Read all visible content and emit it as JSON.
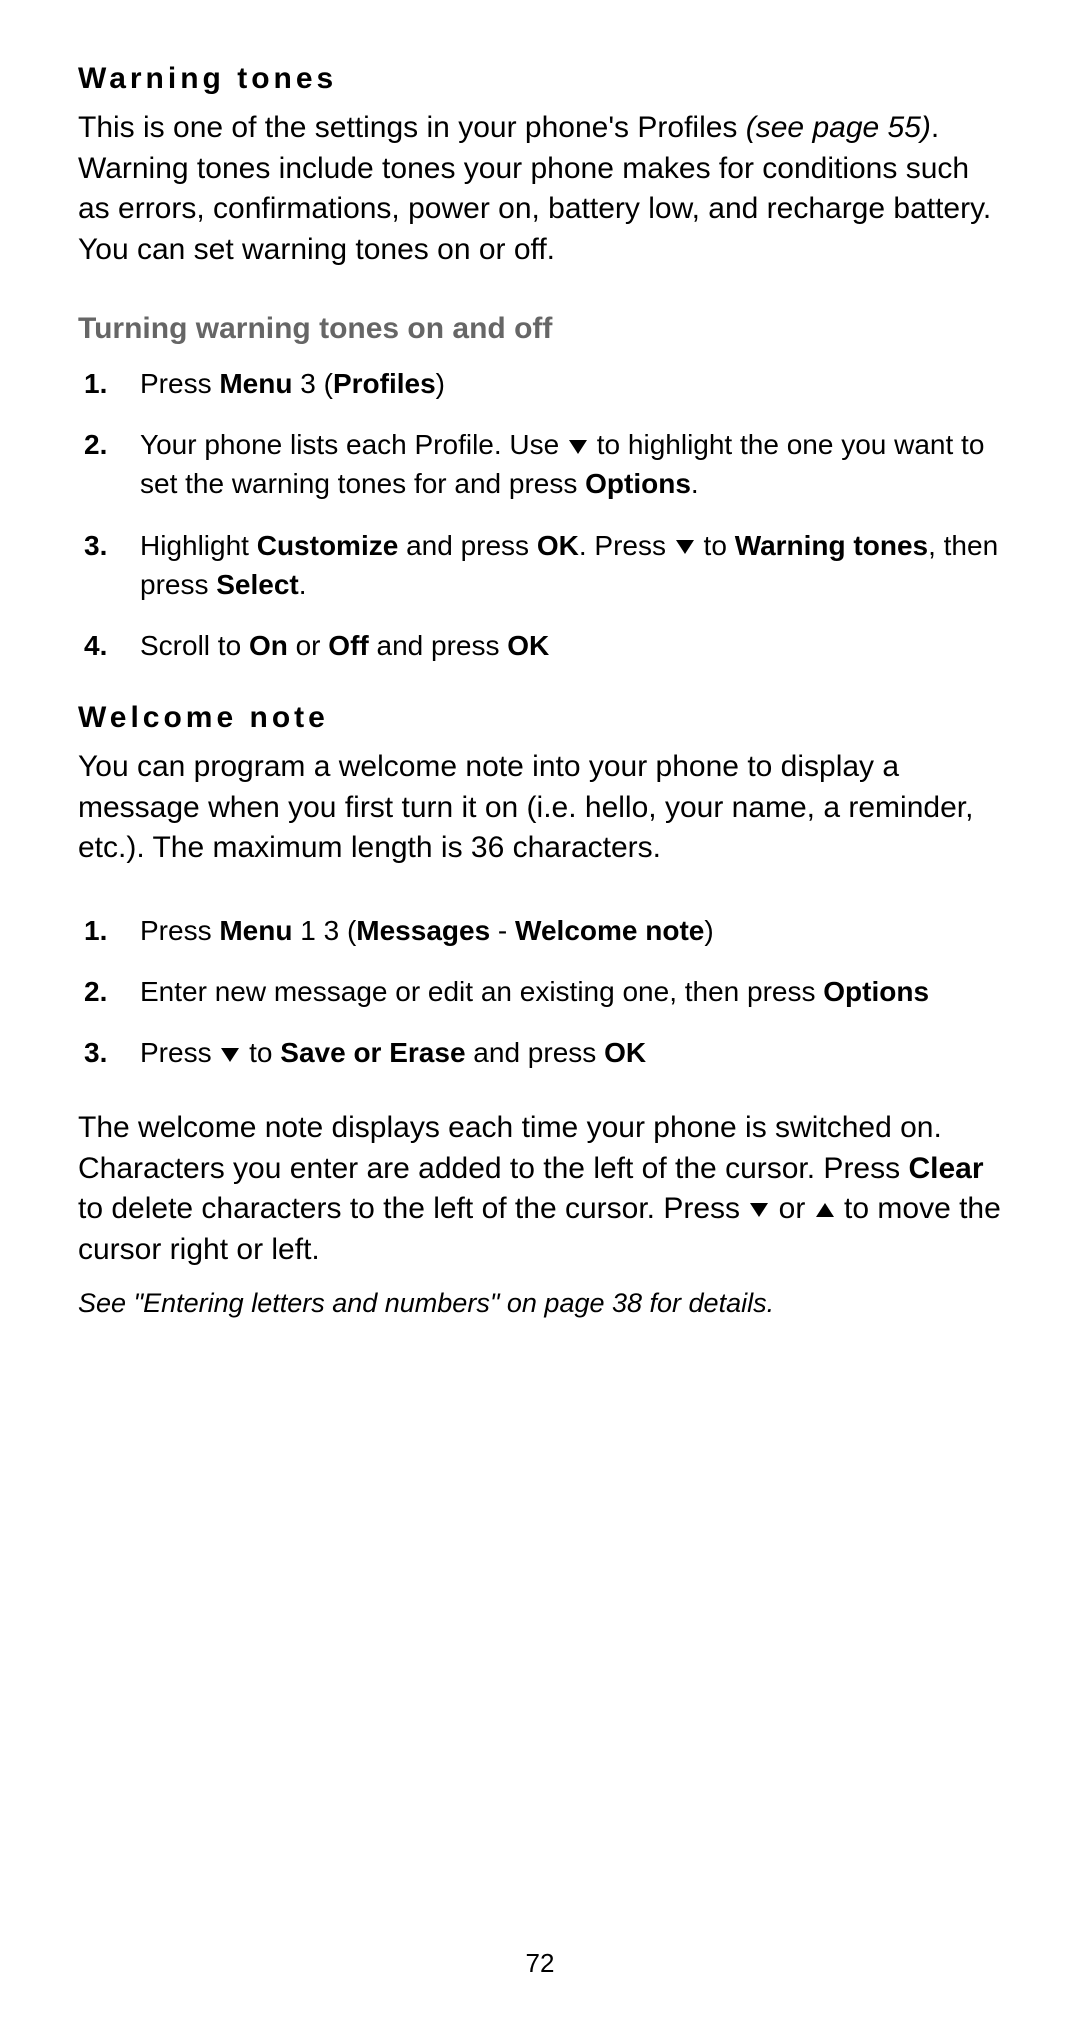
{
  "sections": {
    "warning_tones": {
      "heading": "Warning tones",
      "body_pre": "This is one of the settings in your phone's Profiles ",
      "body_ref": "(see page 55)",
      "body_post": ". Warning tones include tones your phone makes for conditions such as errors, confirmations, power on, battery low, and recharge battery. You can set warning tones on or off."
    },
    "turning": {
      "heading": "Turning warning tones on and off",
      "items": {
        "1": {
          "num": "1.",
          "t1": "Press ",
          "b1": "Menu",
          "t2": " 3 (",
          "b2": "Profiles",
          "t3": ")"
        },
        "2": {
          "num": "2.",
          "t1": "Your phone lists each Profile. Use ",
          "t2": " to highlight the one you want to set the warning tones for and press ",
          "b1": "Options",
          "t3": "."
        },
        "3": {
          "num": "3.",
          "t1": "Highlight ",
          "b1": "Customize",
          "t2": " and press ",
          "b2": "OK",
          "t3": ". Press ",
          "t4": " to ",
          "b3": "Warning tones",
          "t5": ", then press ",
          "b4": "Select",
          "t6": "."
        },
        "4": {
          "num": "4.",
          "t1": "Scroll to ",
          "b1": "On",
          "t2": " or ",
          "b2": "Off",
          "t3": " and press ",
          "b3": "OK"
        }
      }
    },
    "welcome": {
      "heading": "Welcome note",
      "body": "You can program a welcome note into your phone to display a message when you first turn it on (i.e. hello, your name, a reminder, etc.). The maximum length is 36 characters.",
      "items": {
        "1": {
          "num": "1.",
          "t1": "Press ",
          "b1": "Menu",
          "t2": " 1 3 (",
          "b2": "Messages",
          "t3": " - ",
          "b3": "Welcome note",
          "t4": ")"
        },
        "2": {
          "num": "2.",
          "t1": "Enter new message or edit an existing one, then press ",
          "b1": "Options"
        },
        "3": {
          "num": "3.",
          "t1": "Press ",
          "t2": " to ",
          "b1": "Save or Erase",
          "t3": " and press ",
          "b2": "OK"
        }
      },
      "after_pre": "The welcome note displays each time your phone is switched on. Characters you enter are added to the left of the cursor. Press ",
      "after_b1": "Clear",
      "after_mid": " to delete characters to the left of the cursor. Press ",
      "after_or": " or ",
      "after_post": " to move the cursor right or left.",
      "footer": "See \"Entering letters and numbers\" on page 38 for details."
    }
  },
  "page_number": "72"
}
